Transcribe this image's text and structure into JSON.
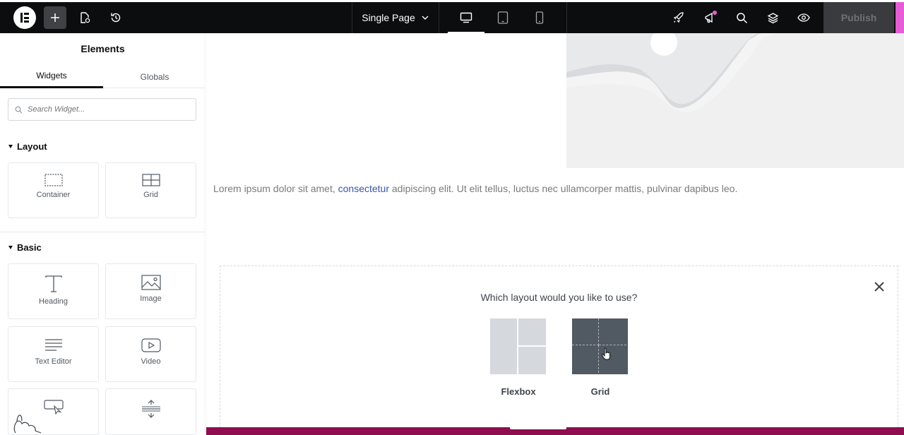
{
  "topbar": {
    "icons": [
      "elementor-logo-icon",
      "plus-icon",
      "page-settings-icon",
      "history-icon",
      "chevron-down-icon",
      "desktop-icon",
      "tablet-icon",
      "mobile-icon",
      "rocket-icon",
      "megaphone-icon",
      "search-icon",
      "layers-icon",
      "eye-icon"
    ],
    "document_title": "Single Page",
    "publish_label": "Publish",
    "notification_dot_color": "#e65cd6"
  },
  "panel": {
    "title": "Elements",
    "tabs": [
      {
        "label": "Widgets",
        "active": true
      },
      {
        "label": "Globals",
        "active": false
      }
    ],
    "search_placeholder": "Search Widget...",
    "sections": [
      {
        "title": "Layout",
        "widgets": [
          {
            "label": "Container",
            "icon": "container-icon"
          },
          {
            "label": "Grid",
            "icon": "grid-icon"
          }
        ]
      },
      {
        "title": "Basic",
        "widgets": [
          {
            "label": "Heading",
            "icon": "heading-icon"
          },
          {
            "label": "Image",
            "icon": "image-icon"
          },
          {
            "label": "Text Editor",
            "icon": "text-editor-icon"
          },
          {
            "label": "Video",
            "icon": "video-icon"
          },
          {
            "label": "",
            "icon": "button-icon"
          },
          {
            "label": "",
            "icon": "divider-icon"
          }
        ]
      }
    ]
  },
  "canvas": {
    "text_before_link": "Lorem ipsum dolor sit amet, ",
    "link_text": "consectetur",
    "text_after_link": " adipiscing elit. Ut elit tellus, luctus nec ullamcorper mattis, pulvinar dapibus leo.",
    "layout_prompt": {
      "question": "Which layout would you like to use?",
      "options": [
        {
          "label": "Flexbox",
          "selected": false
        },
        {
          "label": "Grid",
          "selected": true
        }
      ]
    }
  },
  "colors": {
    "topbar_bg": "#0c0d0e",
    "link": "#3658a8",
    "bottom_strip": "#8f0e4f"
  }
}
